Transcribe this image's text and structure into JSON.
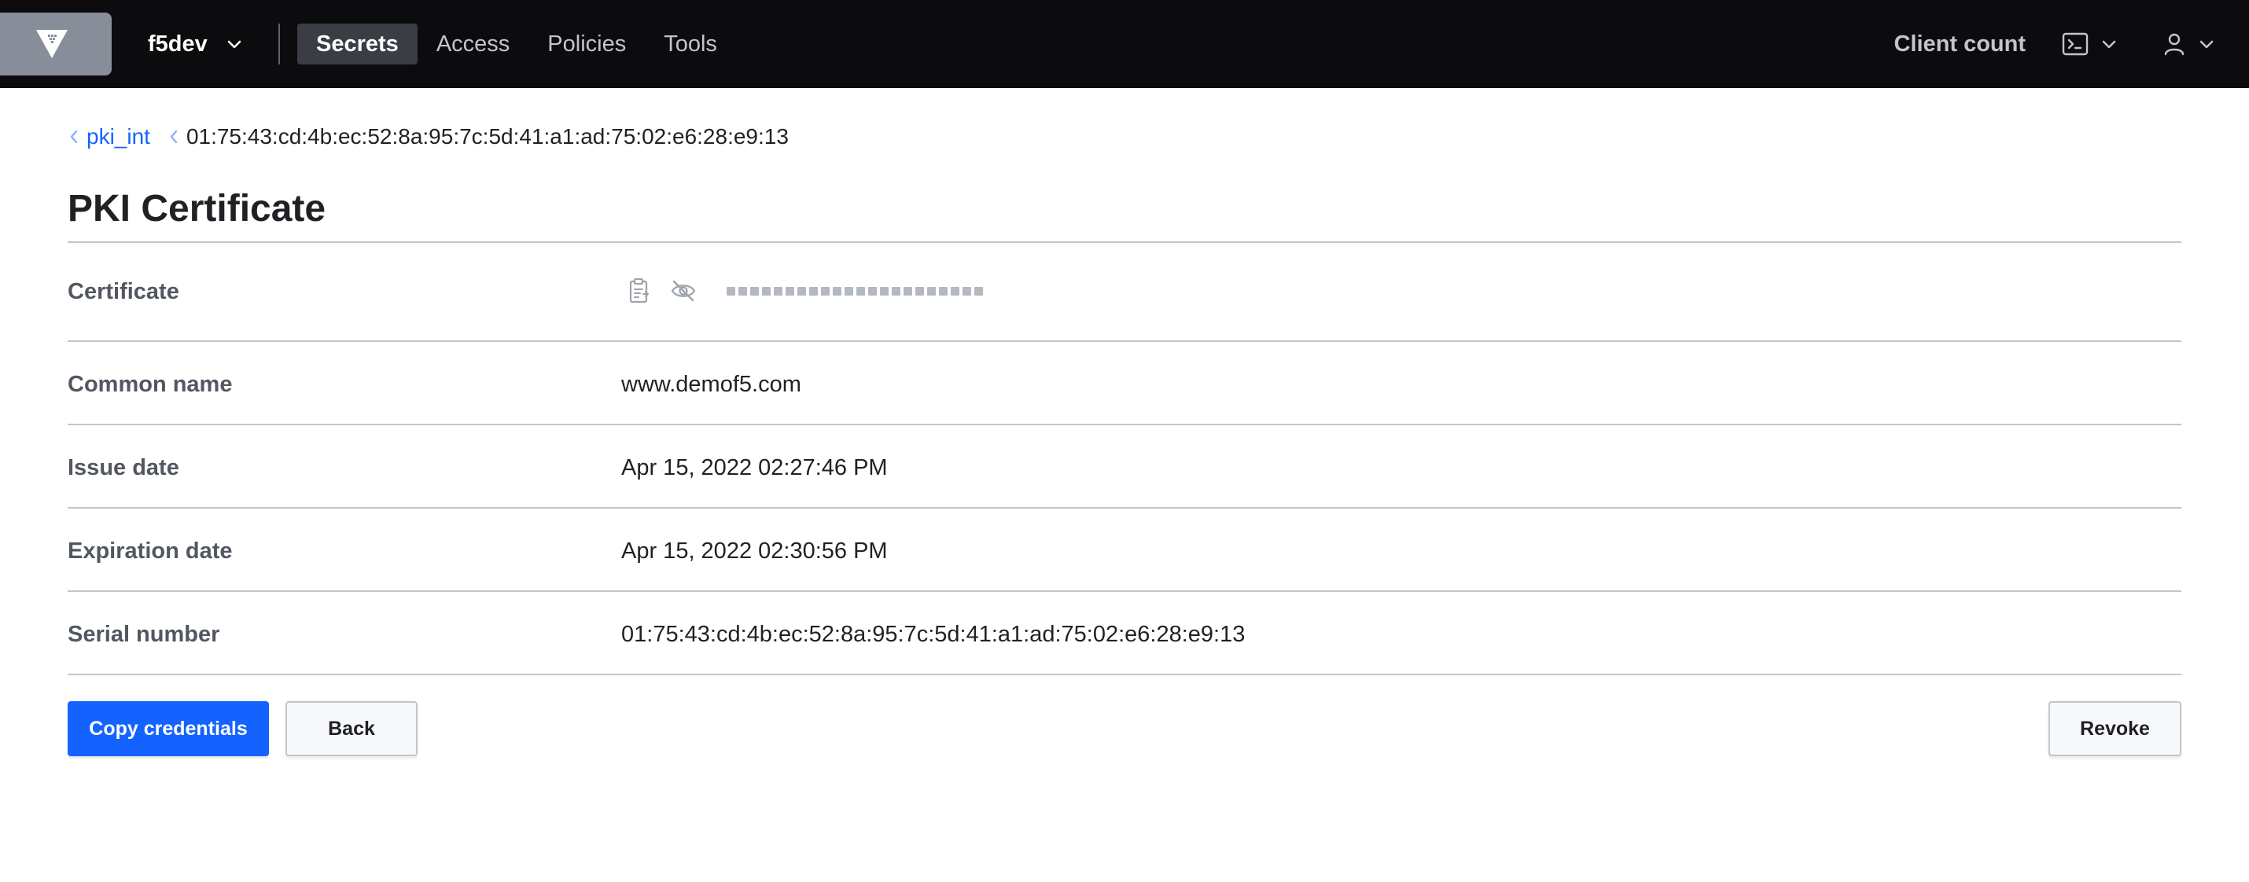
{
  "nav": {
    "namespace": "f5dev",
    "links": [
      {
        "label": "Secrets",
        "active": true
      },
      {
        "label": "Access",
        "active": false
      },
      {
        "label": "Policies",
        "active": false
      },
      {
        "label": "Tools",
        "active": false
      }
    ],
    "client_count": "Client count",
    "icons": [
      "vault-logo-icon",
      "chevron-down-icon",
      "console-icon",
      "user-icon"
    ]
  },
  "breadcrumb": {
    "parent": "pki_int",
    "current": "01:75:43:cd:4b:ec:52:8a:95:7c:5d:41:a1:ad:75:02:e6:28:e9:13"
  },
  "page": {
    "title": "PKI Certificate"
  },
  "fields": {
    "certificate": {
      "label": "Certificate"
    },
    "common_name": {
      "label": "Common name",
      "value": "www.demof5.com"
    },
    "issue_date": {
      "label": "Issue date",
      "value": "Apr 15, 2022 02:27:46 PM"
    },
    "expiration_date": {
      "label": "Expiration date",
      "value": "Apr 15, 2022 02:30:56 PM"
    },
    "serial_number": {
      "label": "Serial number",
      "value": "01:75:43:cd:4b:ec:52:8a:95:7c:5d:41:a1:ad:75:02:e6:28:e9:13"
    }
  },
  "actions": {
    "copy_credentials": "Copy credentials",
    "back": "Back",
    "revoke": "Revoke"
  },
  "colors": {
    "topbar": "#0c0c0e",
    "accent": "#1563ff",
    "label": "#525761",
    "divider": "#c2c5cb"
  }
}
